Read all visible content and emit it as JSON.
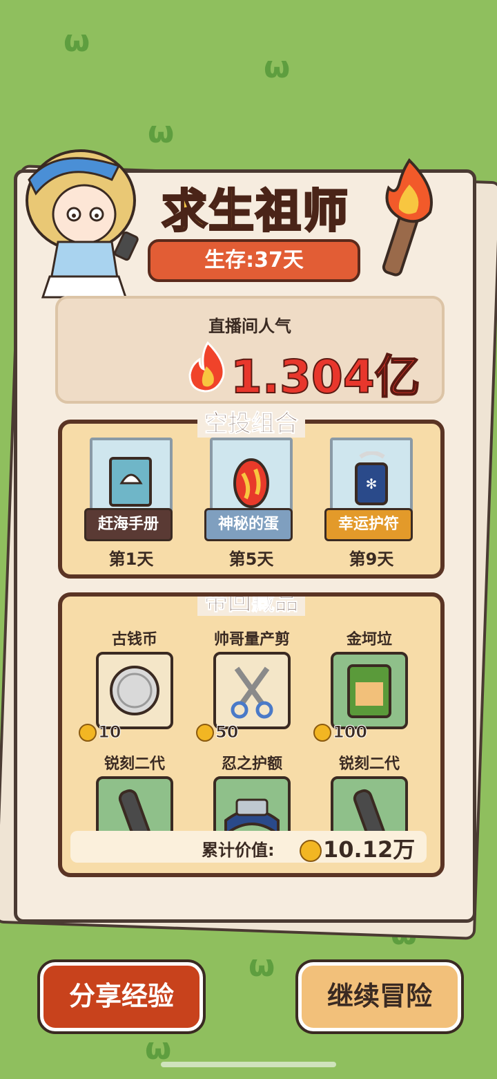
{
  "header": {
    "title": "求生祖师",
    "survival_label": "生存:37天"
  },
  "popularity": {
    "label": "直播间人气",
    "value": "1.304亿"
  },
  "airdrop": {
    "title": "空投组合",
    "items": [
      {
        "name": "赶海手册",
        "day": "第1天",
        "tag_color": "#5a3a34",
        "icon": "shell-book-icon"
      },
      {
        "name": "神秘的蛋",
        "day": "第5天",
        "tag_color": "#7f9fbf",
        "icon": "mystery-egg-icon"
      },
      {
        "name": "幸运护符",
        "day": "第9天",
        "tag_color": "#e39a2a",
        "icon": "lucky-charm-icon"
      }
    ]
  },
  "collection": {
    "title": "带回藏品",
    "items": [
      {
        "name": "古钱币",
        "price": "10",
        "icon": "ancient-coin-icon",
        "bg": "#f4e6c8"
      },
      {
        "name": "帅哥量产剪",
        "price": "50",
        "icon": "scissors-icon",
        "bg": "#f4e6c8"
      },
      {
        "name": "金坷垃",
        "price": "100",
        "icon": "fertilizer-bag-icon",
        "bg": "#8fc08a"
      },
      {
        "name": "锐刻二代",
        "price": "",
        "icon": "vape-icon",
        "bg": "#8fc08a"
      },
      {
        "name": "忍之护额",
        "price": "",
        "icon": "ninja-headband-icon",
        "bg": "#8fc08a"
      },
      {
        "name": "锐刻二代",
        "price": "",
        "icon": "vape-icon",
        "bg": "#8fc08a"
      }
    ],
    "total_label": "累计价值:",
    "total_value": "10.12万"
  },
  "buttons": {
    "share": "分享经验",
    "continue": "继续冒险"
  },
  "colors": {
    "grass": "#8fbf5e",
    "share_btn": "#c8421c",
    "continue_btn": "#f2c07a"
  }
}
